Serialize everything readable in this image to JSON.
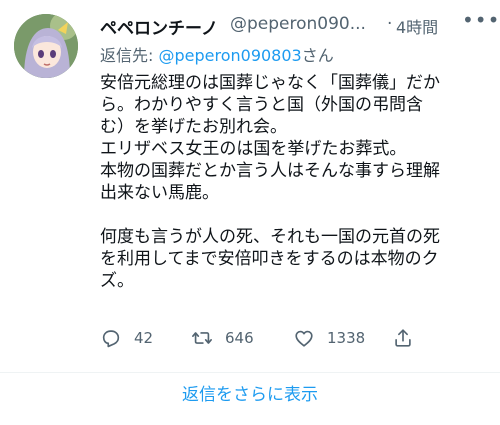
{
  "tweet": {
    "display_name": "ペペロンチーノ",
    "handle": "@peperon090...",
    "separator": "·",
    "time": "4時間",
    "more_icon": "more-icon",
    "reply_prefix": "返信先: ",
    "reply_mention": "@peperon090803",
    "reply_suffix": "さん",
    "body_lines": [
      "安倍元総理のは国葬じゃなく「国葬儀」だか",
      "ら。わかりやすく言うと国（外国の弔問含",
      "む）を挙げたお別れ会。",
      "エリザベス女王のは国を挙げたお葬式。",
      "本物の国葬だとか言う人はそんな事すら理解",
      "出来ない馬鹿。",
      "",
      "何度も言うが人の死、それも一国の元首の死",
      "を利用してまで安倍叩きをするのは本物のク",
      "ズ。"
    ],
    "actions": {
      "reply": {
        "icon": "reply-icon",
        "count": "42"
      },
      "retweet": {
        "icon": "retweet-icon",
        "count": "646"
      },
      "like": {
        "icon": "heart-icon",
        "count": "1338"
      },
      "share": {
        "icon": "share-icon"
      }
    }
  },
  "show_more_label": "返信をさらに表示",
  "colors": {
    "text": "#0f1419",
    "secondary": "#536471",
    "accent": "#1d9bf0",
    "divider": "#eff3f4"
  }
}
